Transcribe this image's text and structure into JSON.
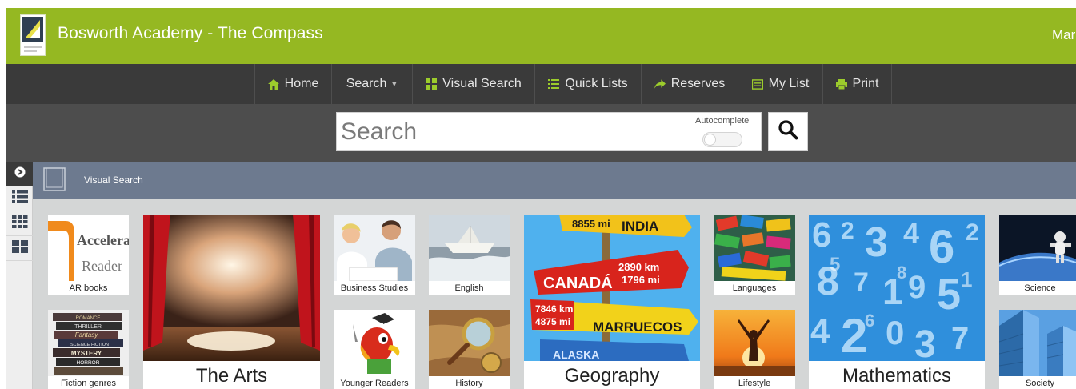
{
  "header": {
    "title": "Bosworth Academy - The Compass",
    "user_text": "Mar"
  },
  "nav": {
    "items": [
      {
        "label": "Home",
        "icon": "home-icon"
      },
      {
        "label": "Search",
        "icon": "caret-down-icon"
      },
      {
        "label": "Visual Search",
        "icon": "grid-icon"
      },
      {
        "label": "Quick Lists",
        "icon": "list-icon"
      },
      {
        "label": "Reserves",
        "icon": "share-arrow-icon"
      },
      {
        "label": "My List",
        "icon": "list-box-icon"
      },
      {
        "label": "Print",
        "icon": "printer-icon"
      }
    ]
  },
  "search": {
    "placeholder": "Search",
    "autocomplete_label": "Autocomplete",
    "autocomplete_on": false
  },
  "breadcrumb": {
    "label": "Visual Search"
  },
  "tiles": [
    {
      "label": "AR books",
      "logo_line1": "Accelerated",
      "logo_line2": "Reader"
    },
    {
      "label": "Fiction genres",
      "spines": [
        "ROMANCE",
        "THRILLER",
        "Fantasy",
        "SCIENCE FICTION",
        "MYSTERY",
        "HORROR"
      ]
    },
    {
      "label": "The Arts"
    },
    {
      "label": "Business Studies"
    },
    {
      "label": "Younger Readers"
    },
    {
      "label": "English"
    },
    {
      "label": "History"
    },
    {
      "label": "Geography",
      "signs": [
        "8855 mi",
        "INDIA",
        "CANADÁ",
        "2890 km",
        "1796 mi",
        "7846 km",
        "4875 mi",
        "MARRUECOS",
        "ALASKA"
      ]
    },
    {
      "label": "Languages"
    },
    {
      "label": "Lifestyle"
    },
    {
      "label": "Mathematics"
    },
    {
      "label": "Science"
    },
    {
      "label": "Society"
    }
  ],
  "colors": {
    "header_green": "#95b822",
    "nav_dark": "#3a3a3a",
    "search_band": "#4d4d4d",
    "crumb_bar": "#6d7a8f",
    "grid_bg": "#d4d6d6"
  }
}
